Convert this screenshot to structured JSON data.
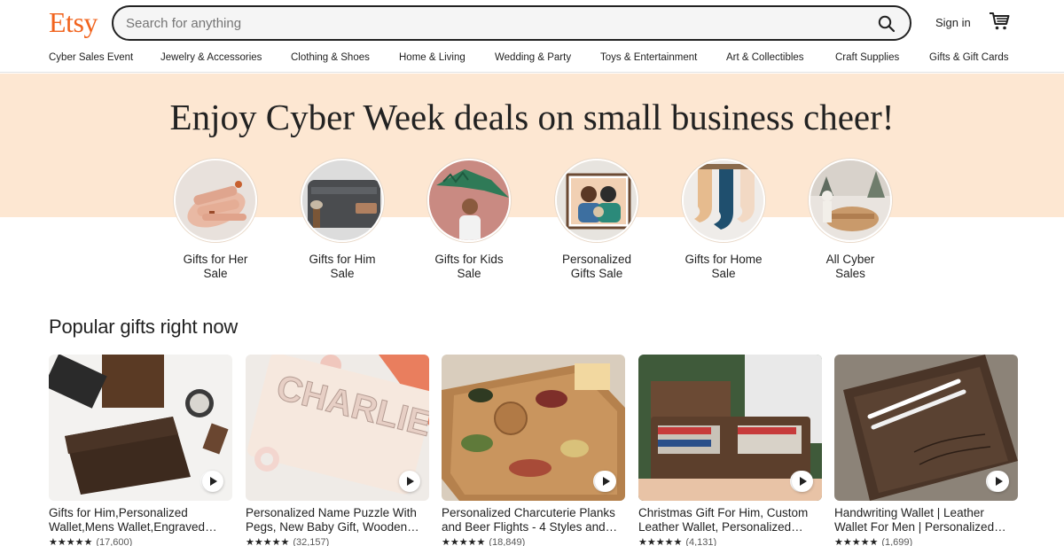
{
  "header": {
    "logo": "Etsy",
    "search_placeholder": "Search for anything",
    "signin_label": "Sign in"
  },
  "nav": {
    "items": [
      "Cyber Sales Event",
      "Jewelry & Accessories",
      "Clothing & Shoes",
      "Home & Living",
      "Wedding & Party",
      "Toys & Entertainment",
      "Art & Collectibles",
      "Craft Supplies",
      "Gifts & Gift Cards"
    ]
  },
  "hero": {
    "title": "Enjoy Cyber Week deals on small business cheer!",
    "categories": [
      {
        "line1": "Gifts for Her",
        "line2": "Sale"
      },
      {
        "line1": "Gifts for Him",
        "line2": "Sale"
      },
      {
        "line1": "Gifts for Kids",
        "line2": "Sale"
      },
      {
        "line1": "Personalized",
        "line2": "Gifts Sale"
      },
      {
        "line1": "Gifts for Home",
        "line2": "Sale"
      },
      {
        "line1": "All Cyber",
        "line2": "Sales"
      }
    ]
  },
  "popular": {
    "title": "Popular gifts right now",
    "items": [
      {
        "title": "Gifts for Him,Personalized Wallet,Mens Wallet,Engraved…",
        "stars": "★★★★★",
        "count": "(17,600)"
      },
      {
        "title": "Personalized Name Puzzle With Pegs, New Baby Gift, Wooden…",
        "stars": "★★★★★",
        "count": "(32,157)"
      },
      {
        "title": "Personalized Charcuterie Planks and Beer Flights - 4 Styles and…",
        "stars": "★★★★★",
        "count": "(18,849)"
      },
      {
        "title": "Christmas Gift For Him, Custom Leather Wallet, Personalized…",
        "stars": "★★★★★",
        "count": "(4,131)"
      },
      {
        "title": "Handwriting Wallet | Leather Wallet For Men | Personalized…",
        "stars": "★★★★★",
        "count": "(1,699)"
      }
    ]
  },
  "colors": {
    "brand": "#f1641e",
    "hero_band": "#fde7d2"
  }
}
